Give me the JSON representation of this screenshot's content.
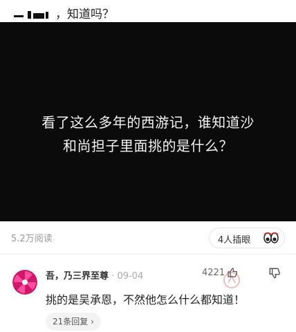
{
  "post": {
    "title_suffix": "，知道吗？"
  },
  "video": {
    "caption_line1": "看了这么多年的西游记，谁知道沙",
    "caption_line2": "和尚担子里面挑的是什么？"
  },
  "stats": {
    "views": "5.2万阅读",
    "reaction_label": "4人插眼",
    "reaction_icon": "eyes-icon"
  },
  "comment": {
    "username": "吾，乃三界至尊",
    "separator": "·",
    "date": "09-04",
    "likes": "4221",
    "text": "挑的是吴承恩，不然他怎么什么都知道！",
    "replies_label": "21条回复 ›"
  },
  "colors": {
    "video_bg": "#0b0b0b",
    "avatar_outer": "#d0186a",
    "avatar_inner": "#ff4fa0",
    "accent_red": "#e23b3b"
  }
}
